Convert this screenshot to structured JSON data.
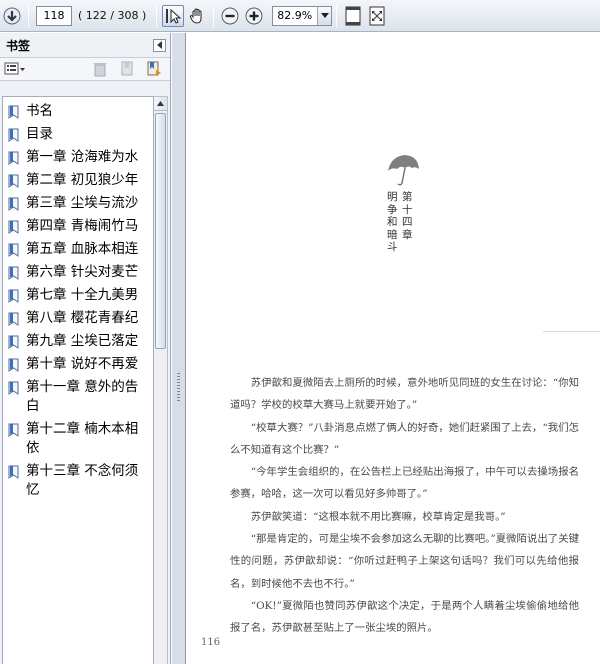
{
  "toolbar": {
    "current_page": "118",
    "page_count": "( 122 / 308 )",
    "zoom": "82.9%"
  },
  "icons": {
    "down_arrow": "arrow-down-circle-icon",
    "select_tool": "select-cursor-icon",
    "hand_tool": "hand-icon",
    "zoom_out": "zoom-out-icon",
    "zoom_in": "zoom-in-icon",
    "fit_page": "fit-page-icon",
    "fit_width": "fit-width-icon"
  },
  "sidebar": {
    "title": "书签",
    "bookmarks": [
      {
        "label": "书名"
      },
      {
        "label": "目录"
      },
      {
        "label": "第一章 沧海难为水"
      },
      {
        "label": "第二章 初见狼少年"
      },
      {
        "label": "第三章 尘埃与流沙"
      },
      {
        "label": "第四章 青梅闹竹马"
      },
      {
        "label": "第五章 血脉本相连"
      },
      {
        "label": "第六章 针尖对麦芒"
      },
      {
        "label": "第七章 十全九美男"
      },
      {
        "label": "第八章 樱花青春纪"
      },
      {
        "label": "第九章 尘埃已落定"
      },
      {
        "label": "第十章 说好不再爱"
      },
      {
        "label": "第十一章 意外的告白"
      },
      {
        "label": "第十二章 楠木本相依"
      },
      {
        "label": "第十三章 不念何须忆"
      }
    ]
  },
  "document": {
    "chapter_title": "第十四章",
    "chapter_subtitle": "明争和暗斗",
    "paragraphs": [
      "苏伊歆和夏微陌去上厕所的时候，意外地听见同班的女生在讨论：“你知道吗？学校的校草大赛马上就要开始了。”",
      "“校草大赛？”八卦消息点燃了俩人的好奇，她们赶紧围了上去，“我们怎么不知道有这个比赛？”",
      "“今年学生会组织的，在公告栏上已经贴出海报了，中午可以去操场报名参赛，哈哈，这一次可以看见好多帅哥了。”",
      "苏伊歆笑道：“这根本就不用比赛嘛，校草肯定是我哥。”",
      "“那是肯定的，可是尘埃不会参加这么无聊的比赛吧。”夏微陌说出了关键性的问题，苏伊歆却说：“你听过赶鸭子上架这句话吗？我们可以先给他报名，到时候他不去也不行。”",
      "“OK!”夏微陌也赞同苏伊歆这个决定，于是两个人瞒着尘埃偷偷地给他报了名，苏伊歆甚至贴上了一张尘埃的照片。"
    ],
    "page_number": "116"
  }
}
